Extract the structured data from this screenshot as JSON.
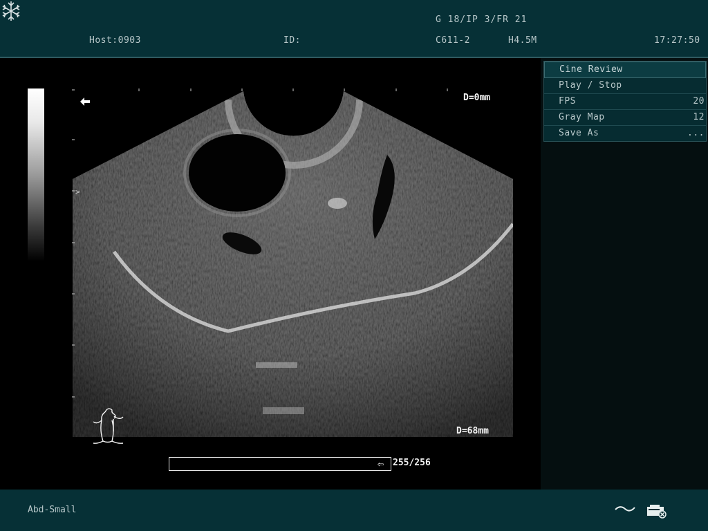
{
  "header": {
    "host": "Host:0903",
    "id": "ID:",
    "params": "G 18/IP 3/FR 21",
    "probe": "C611-2",
    "frequency": "H4.5M",
    "time": "17:27:50",
    "freeze_icon": "snowflake-icon"
  },
  "image": {
    "depth_top": "D=0mm",
    "depth_bottom": "D=68mm",
    "cine_counter": "255/256",
    "cine_progress": 0.996,
    "orientation_marker": ">",
    "body_mark_icon": "body-mark-icon"
  },
  "menu": {
    "title": "Cine Review",
    "items": [
      {
        "label": "Play / Stop",
        "value": ""
      },
      {
        "label": "FPS",
        "value": "20"
      },
      {
        "label": "Gray Map",
        "value": "12"
      },
      {
        "label": "Save As",
        "value": "..."
      }
    ]
  },
  "footer": {
    "preset": "Abd-Small",
    "wave_icon": "wave-icon",
    "print_icon": "printer-icon"
  },
  "colors": {
    "bar_bg": "#063036",
    "text": "#b8c8ca",
    "image_bg": "#000000"
  }
}
